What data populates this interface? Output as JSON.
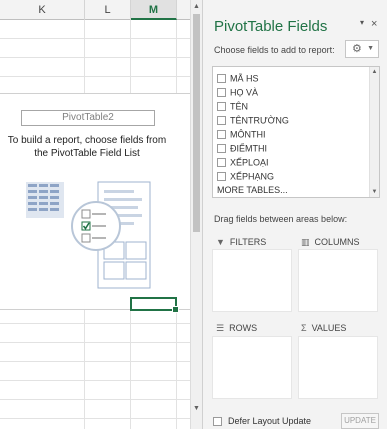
{
  "sheet": {
    "columns": [
      {
        "label": "K",
        "selected": false
      },
      {
        "label": "L",
        "selected": false
      },
      {
        "label": "M",
        "selected": true
      }
    ],
    "pivot": {
      "name": "PivotTable2",
      "message": "To build a report, choose fields from the PivotTable Field List"
    }
  },
  "pane": {
    "title": "PivotTable Fields",
    "close_icon": "×",
    "menu_icon": "▾",
    "choose_label": "Choose fields to add to report:",
    "tools_icon": "⚙",
    "fields": [
      {
        "name": "MÃ HS",
        "checked": false
      },
      {
        "name": "HỌ VÀ",
        "checked": false
      },
      {
        "name": "TÊN",
        "checked": false
      },
      {
        "name": "TÊNTRƯỜNG",
        "checked": false
      },
      {
        "name": "MÔNTHI",
        "checked": false
      },
      {
        "name": "ĐIỂMTHI",
        "checked": false
      },
      {
        "name": "XẾPLOẠI",
        "checked": false
      },
      {
        "name": "XẾPHẠNG",
        "checked": false
      }
    ],
    "more_tables": "MORE TABLES...",
    "drag_label": "Drag fields between areas below:",
    "areas": {
      "filters": "FILTERS",
      "columns": "COLUMNS",
      "rows": "ROWS",
      "values": "VALUES"
    },
    "defer_label": "Defer Layout Update",
    "update_label": "UPDATE"
  },
  "colors": {
    "accent": "#217346"
  }
}
